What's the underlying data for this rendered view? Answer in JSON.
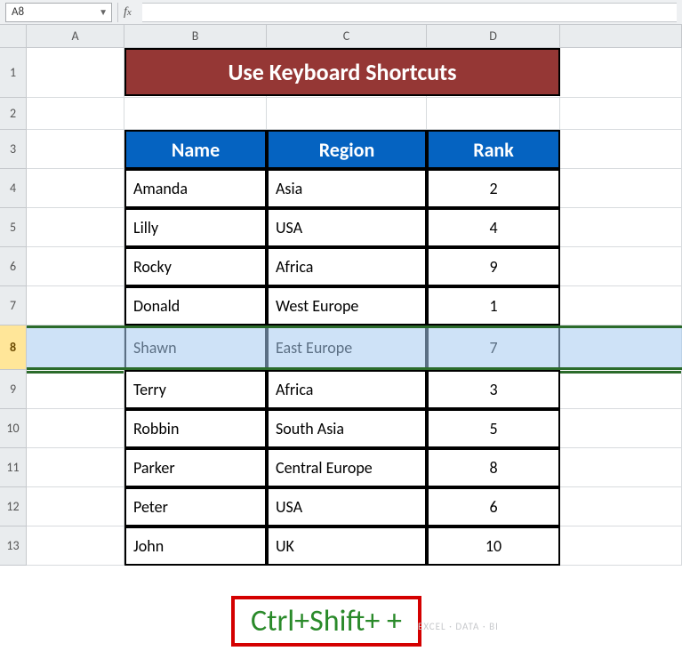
{
  "name_box": "A8",
  "formula_value": "",
  "columns": [
    "A",
    "B",
    "C",
    "D"
  ],
  "rows": [
    "1",
    "2",
    "3",
    "4",
    "5",
    "6",
    "7",
    "8",
    "9",
    "10",
    "11",
    "12",
    "13"
  ],
  "selected_row_index": 7,
  "title": "Use Keyboard Shortcuts",
  "table": {
    "headers": [
      "Name",
      "Region",
      "Rank"
    ],
    "data": [
      {
        "name": "Amanda",
        "region": "Asia",
        "rank": "2"
      },
      {
        "name": "Lilly",
        "region": "USA",
        "rank": "4"
      },
      {
        "name": "Rocky",
        "region": "Africa",
        "rank": "9"
      },
      {
        "name": "Donald",
        "region": "West Europe",
        "rank": "1"
      },
      {
        "name": "Shawn",
        "region": "East Europe",
        "rank": "7"
      },
      {
        "name": "Terry",
        "region": "Africa",
        "rank": "3"
      },
      {
        "name": "Robbin",
        "region": "South Asia",
        "rank": "5"
      },
      {
        "name": "Parker",
        "region": "Central Europe",
        "rank": "8"
      },
      {
        "name": "Peter",
        "region": "USA",
        "rank": "6"
      },
      {
        "name": "John",
        "region": "UK",
        "rank": "10"
      }
    ]
  },
  "callout": "Ctrl+Shift+ +",
  "watermark": "EXCEL · DATA · BI"
}
